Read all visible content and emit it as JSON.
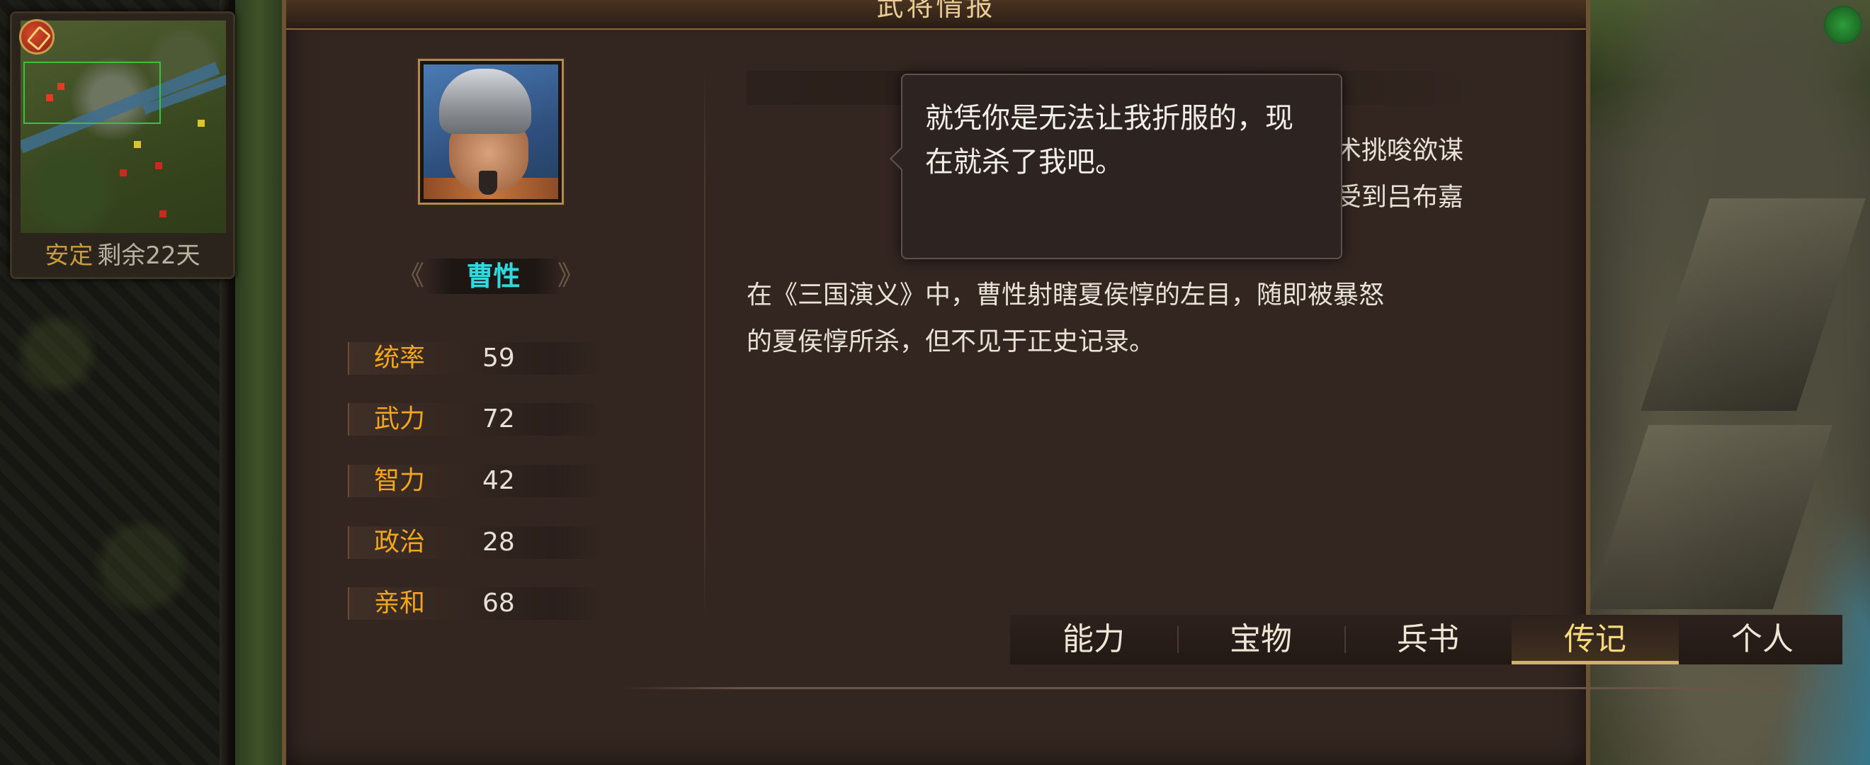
{
  "window": {
    "title": "武将情报"
  },
  "minimap": {
    "status_label": "安定",
    "days_remaining": "剩余22天",
    "badge_icon": "red-emblem-icon"
  },
  "general": {
    "name": "曹性",
    "stats": [
      {
        "label": "统率",
        "value": "59"
      },
      {
        "label": "武力",
        "value": "72"
      },
      {
        "label": "智力",
        "value": "42"
      },
      {
        "label": "政治",
        "value": "28"
      },
      {
        "label": "亲和",
        "value": "68"
      }
    ]
  },
  "dialog": {
    "quote": "就凭你是无法让我折服的，现在就杀了我吧。"
  },
  "biography": {
    "paragraph1_line1": "曹性的上官郝萌曾受袁术挑唆欲谋",
    "paragraph1_line2": "并砍去郝萌一臂，因此受到吕布嘉",
    "paragraph2_line1": "在《三国演义》中，曹性射瞎夏侯惇的左目，随即被暴怒",
    "paragraph2_line2": "的夏侯惇所杀，但不见于正史记录。"
  },
  "tabs": [
    {
      "label": "能力",
      "active": false
    },
    {
      "label": "宝物",
      "active": false
    },
    {
      "label": "兵书",
      "active": false
    },
    {
      "label": "传记",
      "active": true
    },
    {
      "label": "个人",
      "active": false
    }
  ],
  "colors": {
    "stat_label": "#f2a51e",
    "name": "#2fd9e0",
    "active_tab": "#f6d87c",
    "panel_bg": "#332621"
  }
}
